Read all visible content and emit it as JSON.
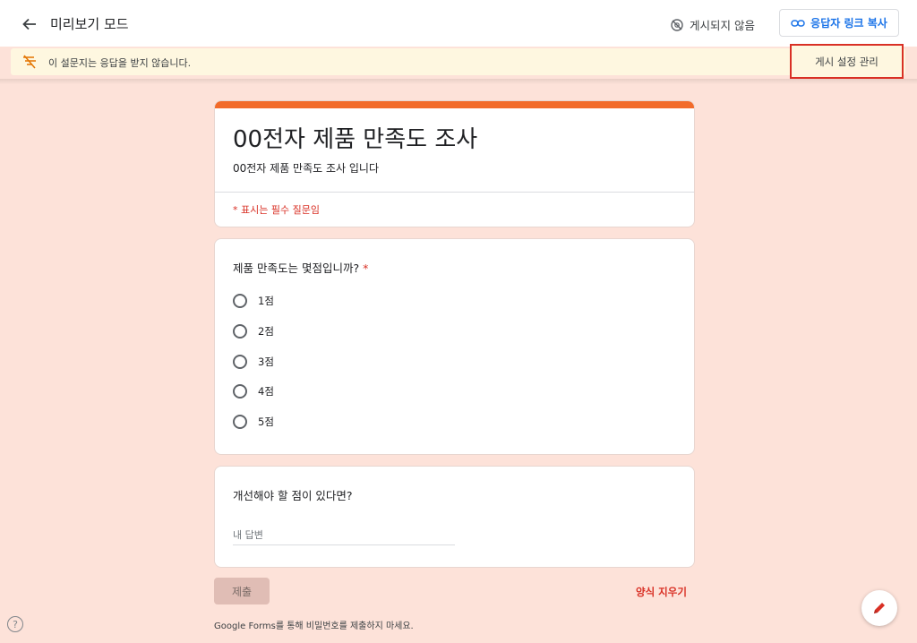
{
  "header": {
    "mode_title": "미리보기 모드",
    "unpublished_label": "게시되지 않음",
    "copy_link_label": "응답자 링크 복사"
  },
  "banner": {
    "message": "이 설문지는 응답을 받지 않습니다.",
    "manage_label": "게시 설정 관리"
  },
  "form": {
    "title": "00전자 제품 만족도 조사",
    "description": "00전자 제품 만족도 조사 입니다",
    "required_note": "* 표시는 필수 질문임",
    "questions": [
      {
        "label": "제품 만족도는 몇점입니까?",
        "required_mark": "*",
        "options": [
          "1점",
          "2점",
          "3점",
          "4점",
          "5점"
        ]
      },
      {
        "label": "개선해야 할 점이 있다면?",
        "placeholder": "내 답변"
      }
    ],
    "submit_label": "제출",
    "clear_label": "양식 지우기",
    "footer_note": "Google Forms를 통해 비밀번호를 제출하지 마세요."
  },
  "icons": {
    "back": "arrow-left-icon",
    "unpublished": "eye-off-icon",
    "link": "link-icon",
    "banner": "no-responses-icon",
    "help": "help-icon",
    "edit": "pencil-icon"
  },
  "colors": {
    "background": "#fde2d9",
    "accent": "#f26b2a",
    "primary_blue": "#1a73e8",
    "required_red": "#d93025",
    "banner_bg": "#fef7e0"
  }
}
